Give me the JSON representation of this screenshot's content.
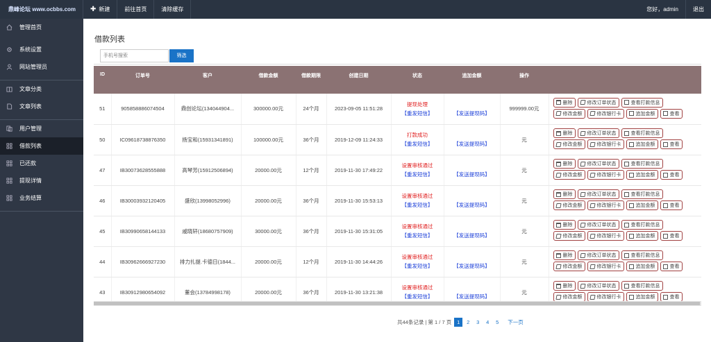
{
  "header": {
    "logo_text": "鼎峰论坛 www.ocbbs.com",
    "nav": [
      {
        "label": "新建",
        "icon": "plus-icon"
      },
      {
        "label": "前往首页"
      },
      {
        "label": "清除缓存"
      }
    ],
    "greeting": "您好，admin",
    "logout": "退出"
  },
  "sidebar": {
    "items": [
      {
        "label": "管理首页",
        "icon": "home-icon"
      },
      {
        "label": "系统设置",
        "icon": "gear-icon"
      },
      {
        "label": "网站管理员",
        "icon": "user-icon"
      },
      {
        "label": "文章分类",
        "icon": "book-icon"
      },
      {
        "label": "文章列表",
        "icon": "file-icon"
      },
      {
        "label": "用户管理",
        "icon": "users-icon"
      },
      {
        "label": "借款列表",
        "icon": "grid-icon"
      },
      {
        "label": "已还款",
        "icon": "grid-icon"
      },
      {
        "label": "提现详情",
        "icon": "grid-icon"
      },
      {
        "label": "业务结算",
        "icon": "grid-icon"
      }
    ],
    "active_index": 6
  },
  "page": {
    "title": "借款列表",
    "search_placeholder": "手机号搜索",
    "search_button": "筛选"
  },
  "table": {
    "columns": [
      "ID",
      "订单号",
      "客户",
      "借款金额",
      "借款期限",
      "创建日期",
      "状态",
      "追加金额",
      "操作"
    ],
    "ops_row1": [
      "删除",
      "修改订单状态",
      "查看打款信息"
    ],
    "ops_row2": [
      "修改金额",
      "修改银行卡",
      "追加金额",
      "查看"
    ],
    "resend_label": "【重发短信】",
    "send_code_label": "【发送提现码】",
    "rows": [
      {
        "id": "51",
        "order": "905858886074504",
        "customer": "鼎创论坛(134044904...",
        "amount": "300000.00元",
        "term": "24个月",
        "date": "2023-09-05 11:51:28",
        "status": "提现处理",
        "extra": "999999.00元"
      },
      {
        "id": "50",
        "order": "IC09618738876350",
        "customer": "扬宝和(15931341891)",
        "amount": "100000.00元",
        "term": "36个月",
        "date": "2019-12-09 11:24:33",
        "status": "打款成功",
        "extra": "元"
      },
      {
        "id": "47",
        "order": "IB30073628555888",
        "customer": "高琴芳(15912506894)",
        "amount": "20000.00元",
        "term": "12个月",
        "date": "2019-11-30 17:49:22",
        "status": "设置审核通过",
        "extra": "元"
      },
      {
        "id": "46",
        "order": "IB30003932120405",
        "customer": "盛欣(13998052996)",
        "amount": "20000.00元",
        "term": "36个月",
        "date": "2019-11-30 15:53:13",
        "status": "设置审核通过",
        "extra": "元"
      },
      {
        "id": "45",
        "order": "IB30990658144133",
        "customer": "戚晓轩(18680757909)",
        "amount": "30000.00元",
        "term": "36个月",
        "date": "2019-11-30 15:31:05",
        "status": "设置审核通过",
        "extra": "元"
      },
      {
        "id": "44",
        "order": "IB30962666927230",
        "customer": "排力扎提.卡德日(1844...",
        "amount": "20000.00元",
        "term": "12个月",
        "date": "2019-11-30 14:44:26",
        "status": "设置审核通过",
        "extra": "元"
      },
      {
        "id": "43",
        "order": "IB30912980654092",
        "customer": "董会(13784998178)",
        "amount": "20000.00元",
        "term": "36个月",
        "date": "2019-11-30 13:21:38",
        "status": "设置审核通过",
        "extra": "元"
      }
    ]
  },
  "pagination": {
    "info": "共44条记录 | 第 1 / 7 页",
    "pages": [
      "1",
      "2",
      "3",
      "4",
      "5"
    ],
    "current": "1",
    "next": "下一页"
  }
}
